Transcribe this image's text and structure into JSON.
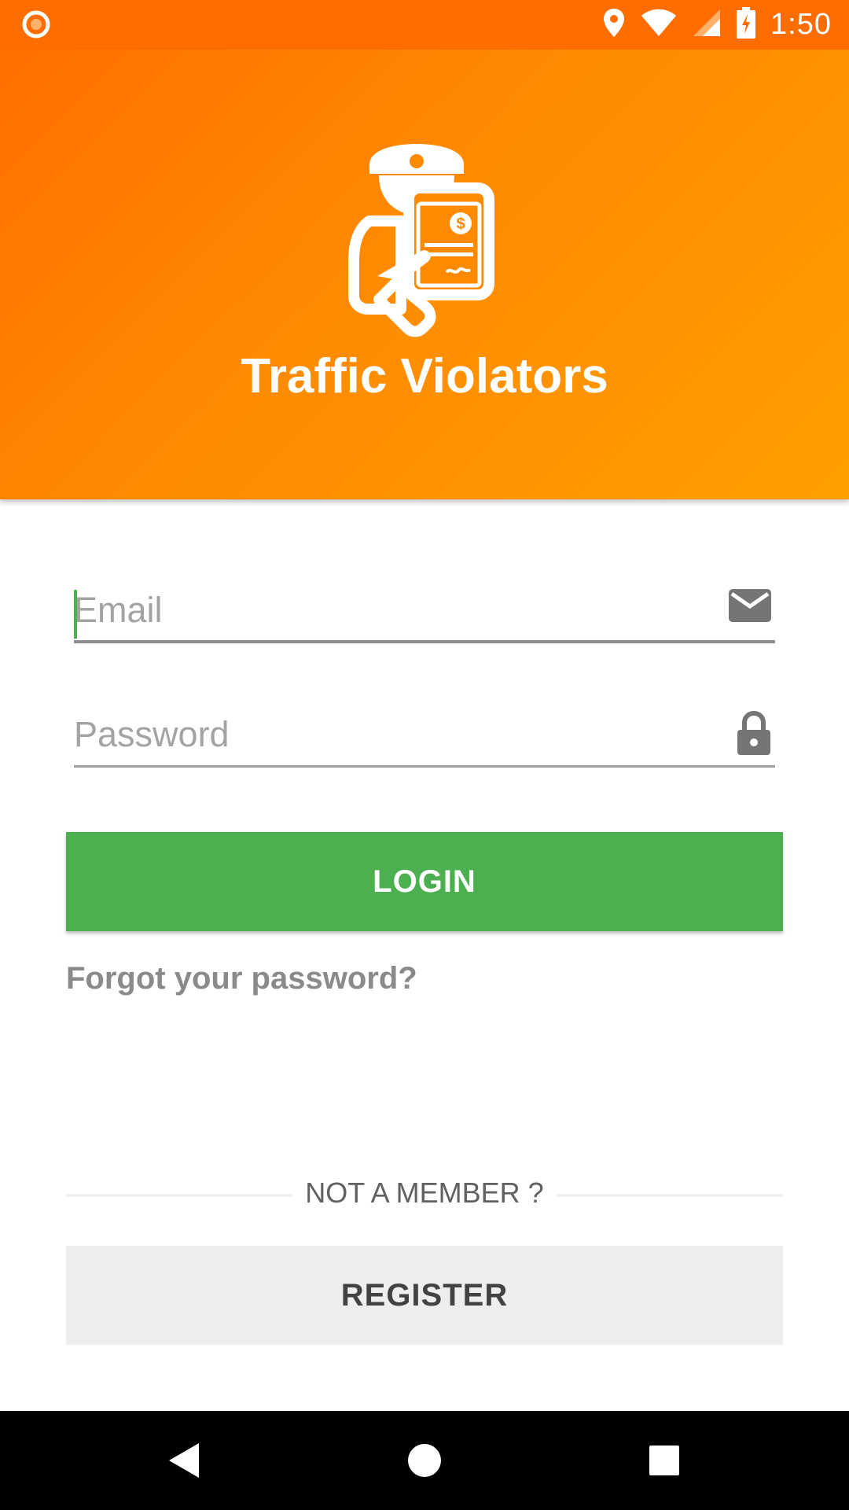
{
  "status_bar": {
    "time": "1:50",
    "icons": [
      "recording-icon",
      "location-icon",
      "wifi-icon",
      "signal-icon",
      "battery-charging-icon"
    ]
  },
  "header": {
    "app_title": "Traffic Violators",
    "logo_icon": "traffic-officer-ticket-icon",
    "colors": {
      "gradient_start": "#ff6f00",
      "gradient_end": "#ff9f00"
    }
  },
  "form": {
    "email": {
      "placeholder": "Email",
      "value": "",
      "icon": "email-icon"
    },
    "password": {
      "placeholder": "Password",
      "value": "",
      "icon": "lock-icon"
    },
    "login_label": "LOGIN",
    "forgot_label": "Forgot your password?",
    "colors": {
      "login_bg": "#4caf50",
      "register_bg": "#eeeeee"
    }
  },
  "register": {
    "divider_text": "NOT A MEMBER ?",
    "register_label": "REGISTER"
  },
  "nav_bar": {
    "buttons": [
      "back-icon",
      "home-icon",
      "recents-icon"
    ]
  }
}
